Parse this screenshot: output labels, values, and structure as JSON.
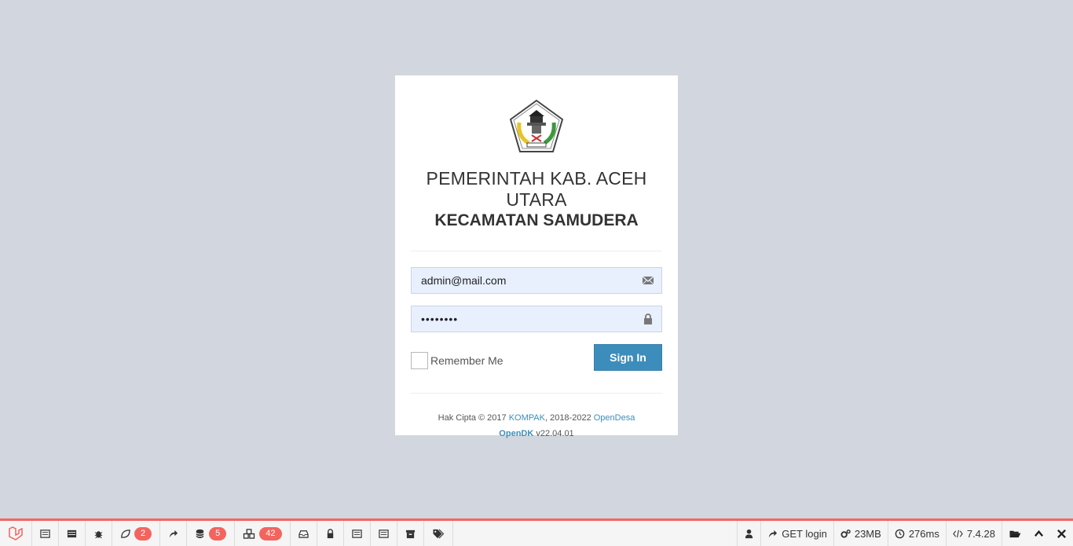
{
  "login": {
    "title_line1": "PEMERINTAH KAB. ACEH UTARA",
    "title_line2": "KECAMATAN SAMUDERA",
    "email_value": "admin@mail.com",
    "password_value": "••••••••",
    "remember_label": "Remember Me",
    "signin_label": "Sign In",
    "logo_icon": "regency-crest-emblem",
    "email_icon": "envelope-icon",
    "password_icon": "lock-icon",
    "footer": {
      "copyright_prefix": "Hak Cipta © 2017",
      "link_kompak": "KOMPAK",
      "middle": ", 2018-2022",
      "link_opendesa": "OpenDesa",
      "link_opendk": "OpenDK",
      "version": "v22.04.01"
    }
  },
  "debugbar": {
    "views_count": "2",
    "queries_count": "5",
    "models_count": "42",
    "route": "GET login",
    "memory": "23MB",
    "time": "276ms",
    "php_version": "7.4.28"
  },
  "colors": {
    "page_bg": "#d2d6de",
    "accent": "#3c8dbc",
    "debug_accent": "#f4645f"
  }
}
